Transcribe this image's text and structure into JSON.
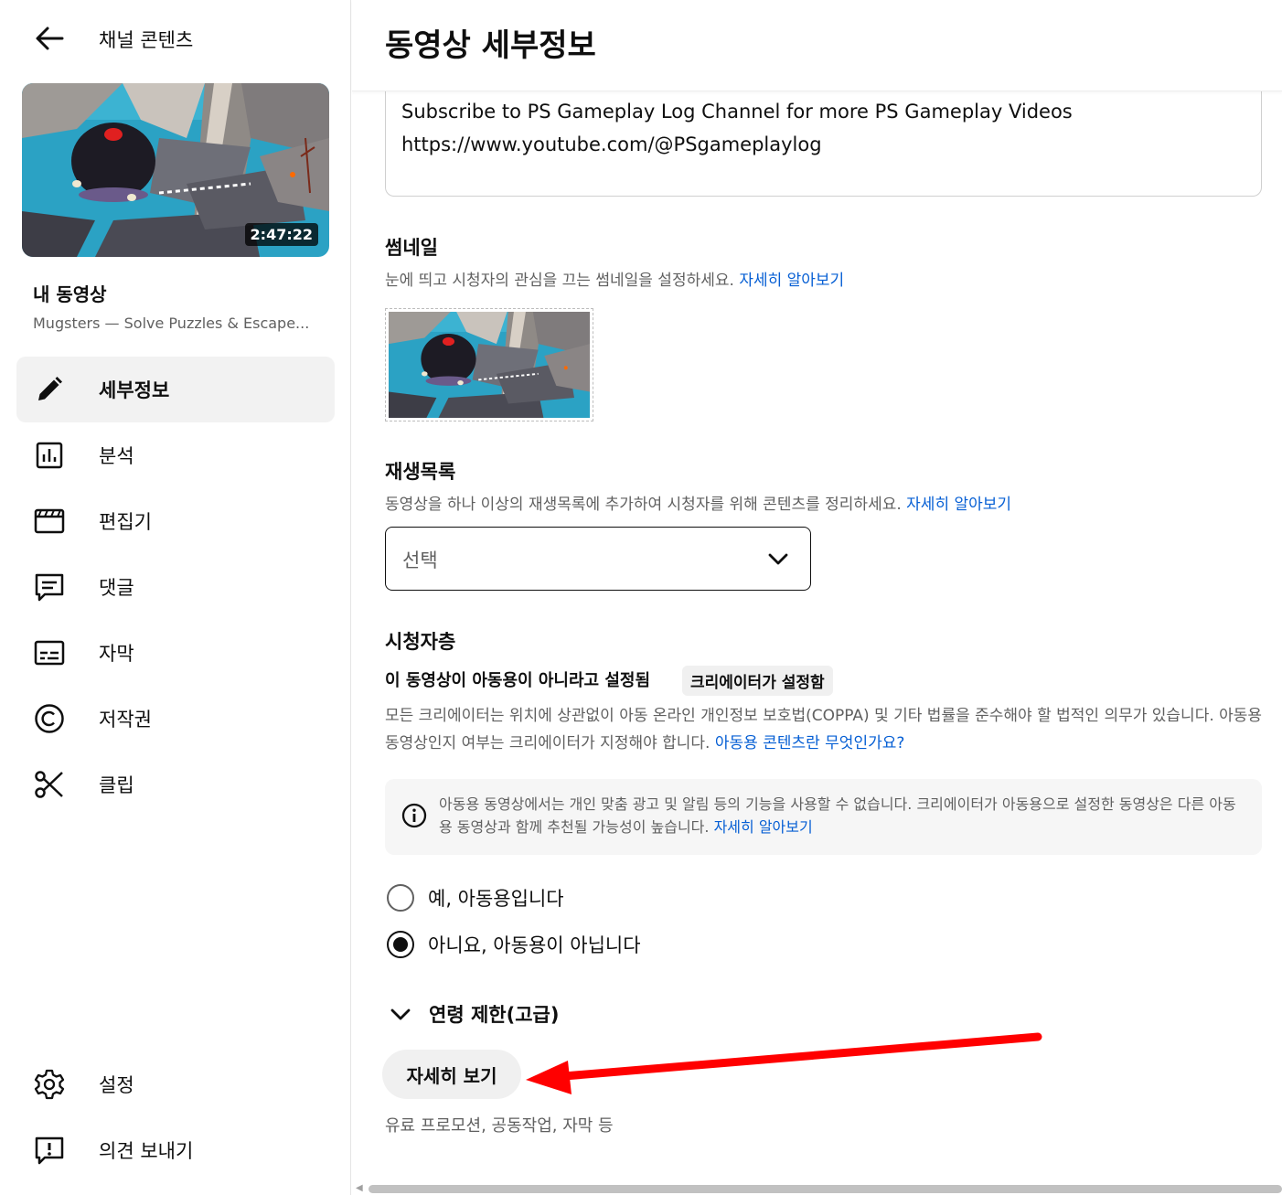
{
  "sidebar": {
    "back_title": "채널 콘텐츠",
    "duration": "2:47:22",
    "my_video_label": "내 동영상",
    "video_title": "Mugsters — Solve Puzzles & Escape...",
    "nav": [
      {
        "label": "세부정보",
        "icon": "pencil-icon",
        "active": true
      },
      {
        "label": "분석",
        "icon": "analytics-icon",
        "active": false
      },
      {
        "label": "편집기",
        "icon": "clapperboard-icon",
        "active": false
      },
      {
        "label": "댓글",
        "icon": "comment-icon",
        "active": false
      },
      {
        "label": "자막",
        "icon": "subtitles-icon",
        "active": false
      },
      {
        "label": "저작권",
        "icon": "copyright-icon",
        "active": false
      },
      {
        "label": "클립",
        "icon": "scissors-icon",
        "active": false
      }
    ],
    "nav_bottom": [
      {
        "label": "설정",
        "icon": "gear-icon"
      },
      {
        "label": "의견 보내기",
        "icon": "feedback-icon"
      }
    ]
  },
  "main": {
    "page_title": "동영상 세부정보",
    "description_lines": [
      "Subscribe to PS Gameplay Log Channel for more PS Gameplay Videos",
      "https://www.youtube.com/@PSgameplaylog"
    ],
    "thumbnail": {
      "title": "썸네일",
      "desc": "눈에 띄고 시청자의 관심을 끄는 썸네일을 설정하세요.",
      "link": "자세히 알아보기"
    },
    "playlist": {
      "title": "재생목록",
      "desc": "동영상을 하나 이상의 재생목록에 추가하여 시청자를 위해 콘텐츠를 정리하세요.",
      "link": "자세히 알아보기",
      "select_value": "선택"
    },
    "audience": {
      "title": "시청자층",
      "status": "이 동영상이 아동용이 아니라고 설정됨",
      "badge": "크리에이터가 설정함",
      "desc": "모든 크리에이터는 위치에 상관없이 아동 온라인 개인정보 보호법(COPPA) 및 기타 법률을 준수해야 할 법적인 의무가 있습니다. 아동용 동영상인지 여부는 크리에이터가 지정해야 합니다.",
      "desc_link": "아동용 콘텐츠란 무엇인가요?",
      "info_text": "아동용 동영상에서는 개인 맞춤 광고 및 알림 등의 기능을 사용할 수 없습니다. 크리에이터가 아동용으로 설정한 동영상은 다른 아동용 동영상과 함께 추천될 가능성이 높습니다.",
      "info_link": "자세히 알아보기",
      "option_yes": "예, 아동용입니다",
      "option_no": "아니요, 아동용이 아닙니다",
      "selected": "no"
    },
    "age_restriction_label": "연령 제한(고급)",
    "more_button": "자세히 보기",
    "more_desc": "유료 프로모션, 공동작업, 자막 등"
  },
  "colors": {
    "link": "#065fd4",
    "annotation_arrow": "#ff0000",
    "text_secondary": "#606060"
  }
}
